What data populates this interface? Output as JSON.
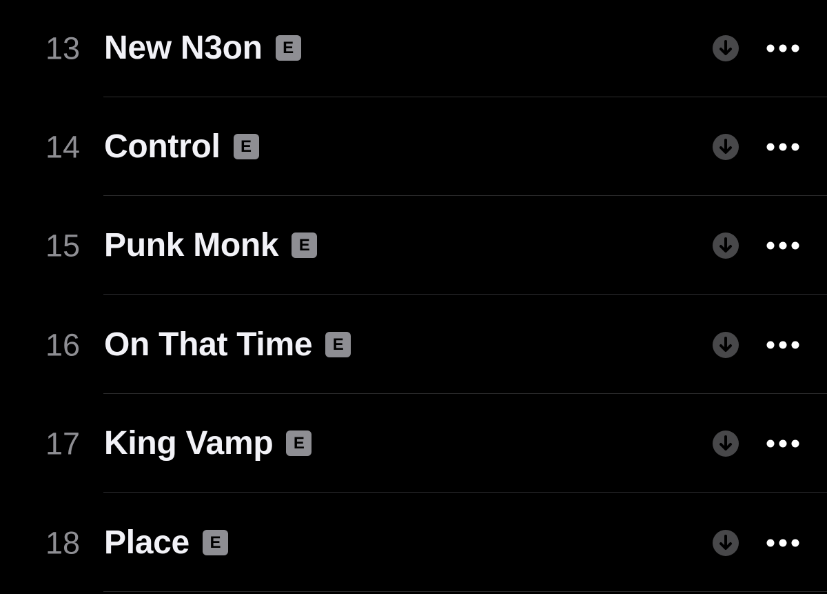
{
  "tracklist": {
    "tracks": [
      {
        "number": "13",
        "title": "New N3on",
        "explicit_label": "E"
      },
      {
        "number": "14",
        "title": "Control",
        "explicit_label": "E"
      },
      {
        "number": "15",
        "title": "Punk Monk",
        "explicit_label": "E"
      },
      {
        "number": "16",
        "title": "On That Time",
        "explicit_label": "E"
      },
      {
        "number": "17",
        "title": "King Vamp",
        "explicit_label": "E"
      },
      {
        "number": "18",
        "title": "Place",
        "explicit_label": "E"
      }
    ]
  },
  "icons": {
    "download": "download-arrow-circle-icon",
    "more": "ellipsis-icon",
    "explicit": "explicit-badge"
  },
  "colors": {
    "background": "#000000",
    "title": "#f2f2f7",
    "number": "#8e8e93",
    "badge": "#8e8e93",
    "download_circle": "#48484a",
    "separator": "#2c2c2e"
  }
}
